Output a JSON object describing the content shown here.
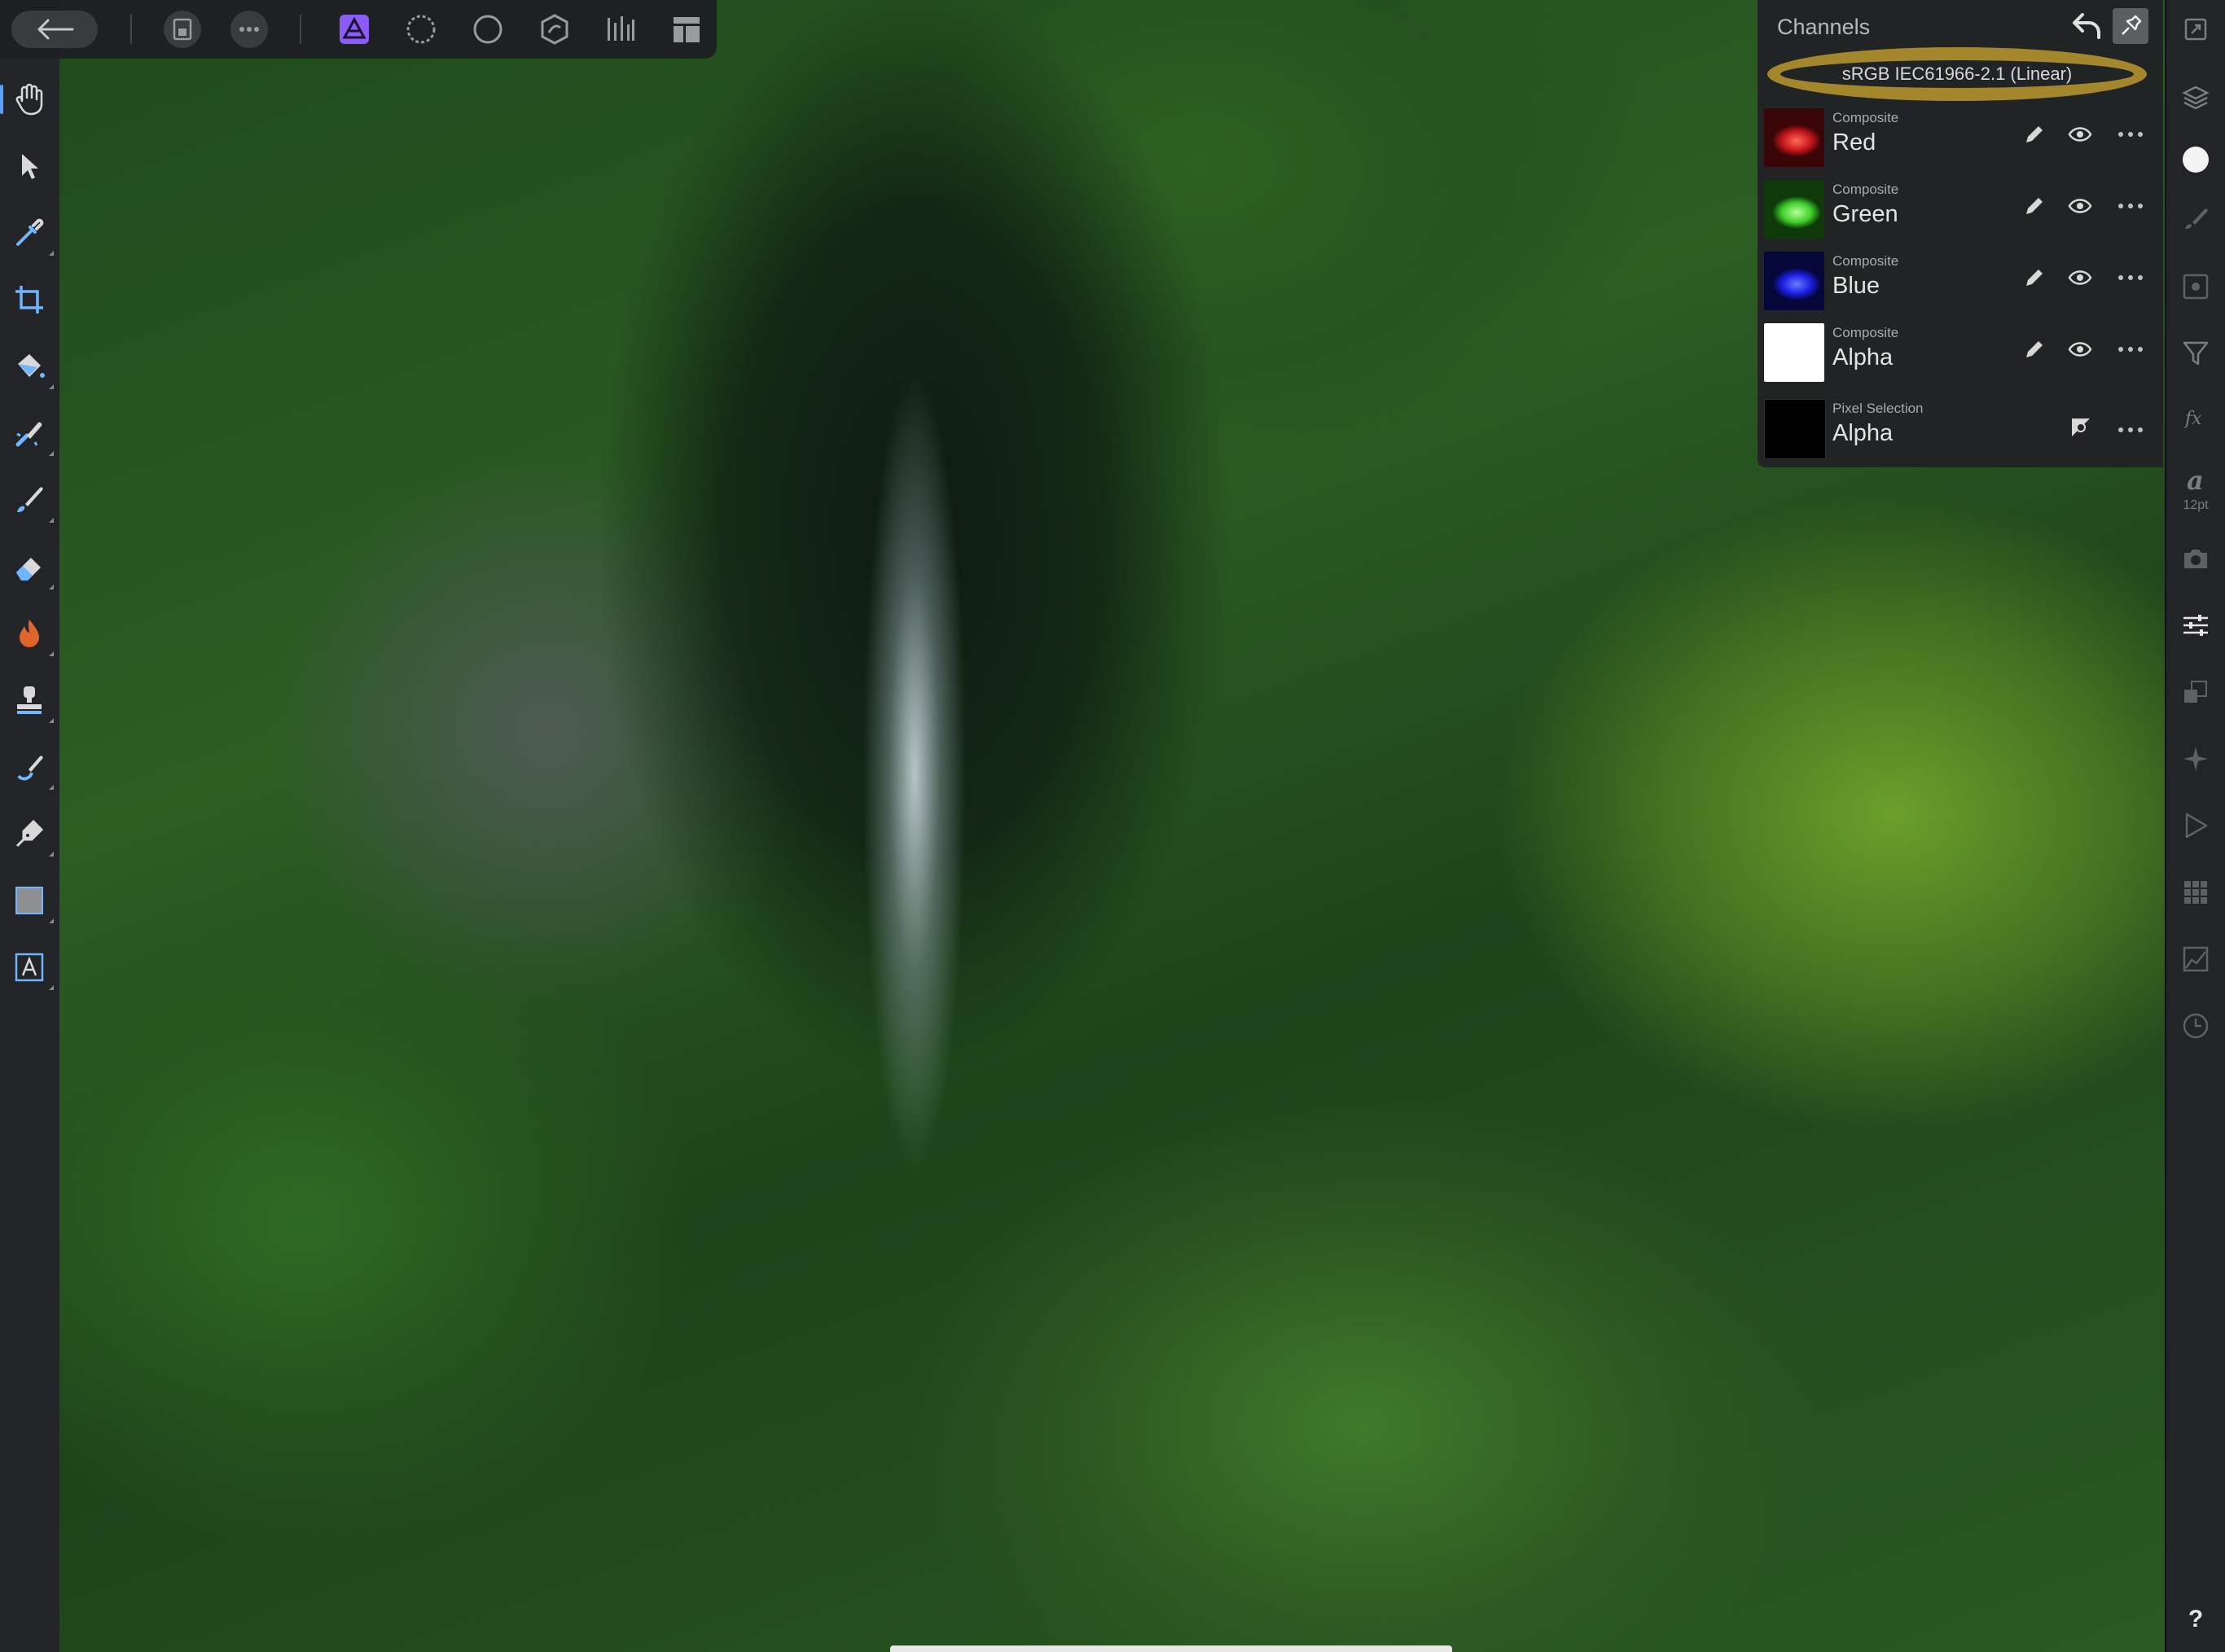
{
  "app": {
    "accent": "#5aa0ff",
    "persona_color": "#8b5cf6"
  },
  "top_toolbar": {
    "icons": [
      "back-arrow-icon",
      "document-icon",
      "more-icon",
      "photo-persona-icon",
      "liquify-persona-icon",
      "develop-persona-icon",
      "tone-mapping-persona-icon",
      "export-persona-icon",
      "layout-icon"
    ]
  },
  "left_tools": {
    "icons": [
      "hand-icon",
      "move-icon",
      "color-picker-icon",
      "crop-icon",
      "flood-fill-icon",
      "selection-brush-icon",
      "paint-brush-icon",
      "eraser-icon",
      "burn-icon",
      "clone-icon",
      "healing-brush-icon",
      "pen-icon",
      "rectangle-icon",
      "text-icon"
    ],
    "selected": "hand-icon"
  },
  "right_studio": {
    "icons": [
      "fullscreen-icon",
      "layers-icon",
      "color-icon",
      "brushes-icon",
      "channels-icon",
      "filter-icon",
      "fx-icon",
      "text-style-icon",
      "camera-icon",
      "adjustments-icon",
      "transform-icon",
      "navigator-icon",
      "play-icon",
      "grid-icon",
      "histogram-icon",
      "history-icon"
    ],
    "font_size_label": "12pt",
    "help_label": "?"
  },
  "channels_panel": {
    "title": "Channels",
    "color_profile": "sRGB IEC61966-2.1 (Linear)",
    "highlight_color": "#c9a32f",
    "channels": [
      {
        "kind": "Composite",
        "name": "Red",
        "thumb_color": "#c4161c"
      },
      {
        "kind": "Composite",
        "name": "Green",
        "thumb_color": "#3fd12c"
      },
      {
        "kind": "Composite",
        "name": "Blue",
        "thumb_color": "#1a1ee0"
      },
      {
        "kind": "Composite",
        "name": "Alpha",
        "thumb_color": "#ffffff"
      },
      {
        "kind": "Pixel Selection",
        "name": "Alpha",
        "thumb_color": "#000000"
      }
    ]
  }
}
